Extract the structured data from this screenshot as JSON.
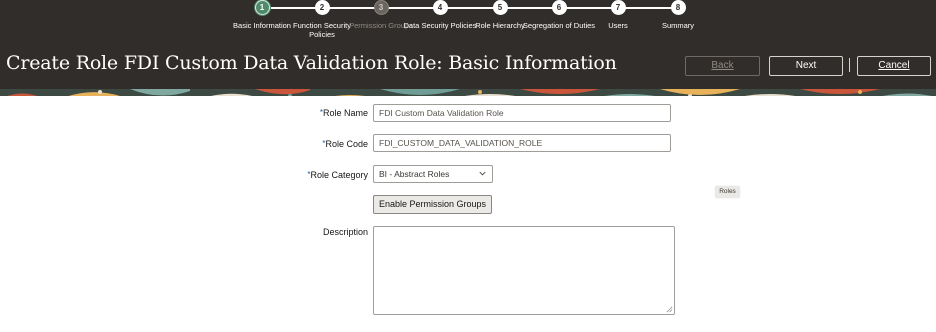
{
  "train": {
    "steps": [
      {
        "num": "1",
        "label": "Basic Information",
        "state": "current"
      },
      {
        "num": "2",
        "label": "Function Security Policies",
        "state": "normal"
      },
      {
        "num": "3",
        "label": "Permission Groups",
        "state": "disabled"
      },
      {
        "num": "4",
        "label": "Data Security Policies",
        "state": "normal"
      },
      {
        "num": "5",
        "label": "Role Hierarchy",
        "state": "normal"
      },
      {
        "num": "6",
        "label": "Segregation of Duties",
        "state": "normal"
      },
      {
        "num": "7",
        "label": "Users",
        "state": "normal"
      },
      {
        "num": "8",
        "label": "Summary",
        "state": "normal"
      }
    ]
  },
  "header": {
    "title": "Create Role FDI Custom Data Validation Role: Basic Information",
    "back_label": "Back",
    "next_label": "Next",
    "cancel_label": "Cancel"
  },
  "form": {
    "required_mark": "*",
    "role_name_label": "Role Name",
    "role_name_value": "FDI Custom Data Validation Role",
    "role_code_label": "Role Code",
    "role_code_value": "FDI_CUSTOM_DATA_VALIDATION_ROLE",
    "role_category_label": "Role Category",
    "role_category_value": "BI - Abstract Roles",
    "enable_button_label": "Enable Permission Groups",
    "description_label": "Description",
    "description_value": ""
  },
  "tooltip": {
    "text": "Roles"
  },
  "colors": {
    "header_bg": "#312d2a",
    "current_step": "#4f8a6b",
    "required": "#1f5a99"
  },
  "icons": [
    "chevron-down-icon",
    "resize-handle-icon"
  ]
}
